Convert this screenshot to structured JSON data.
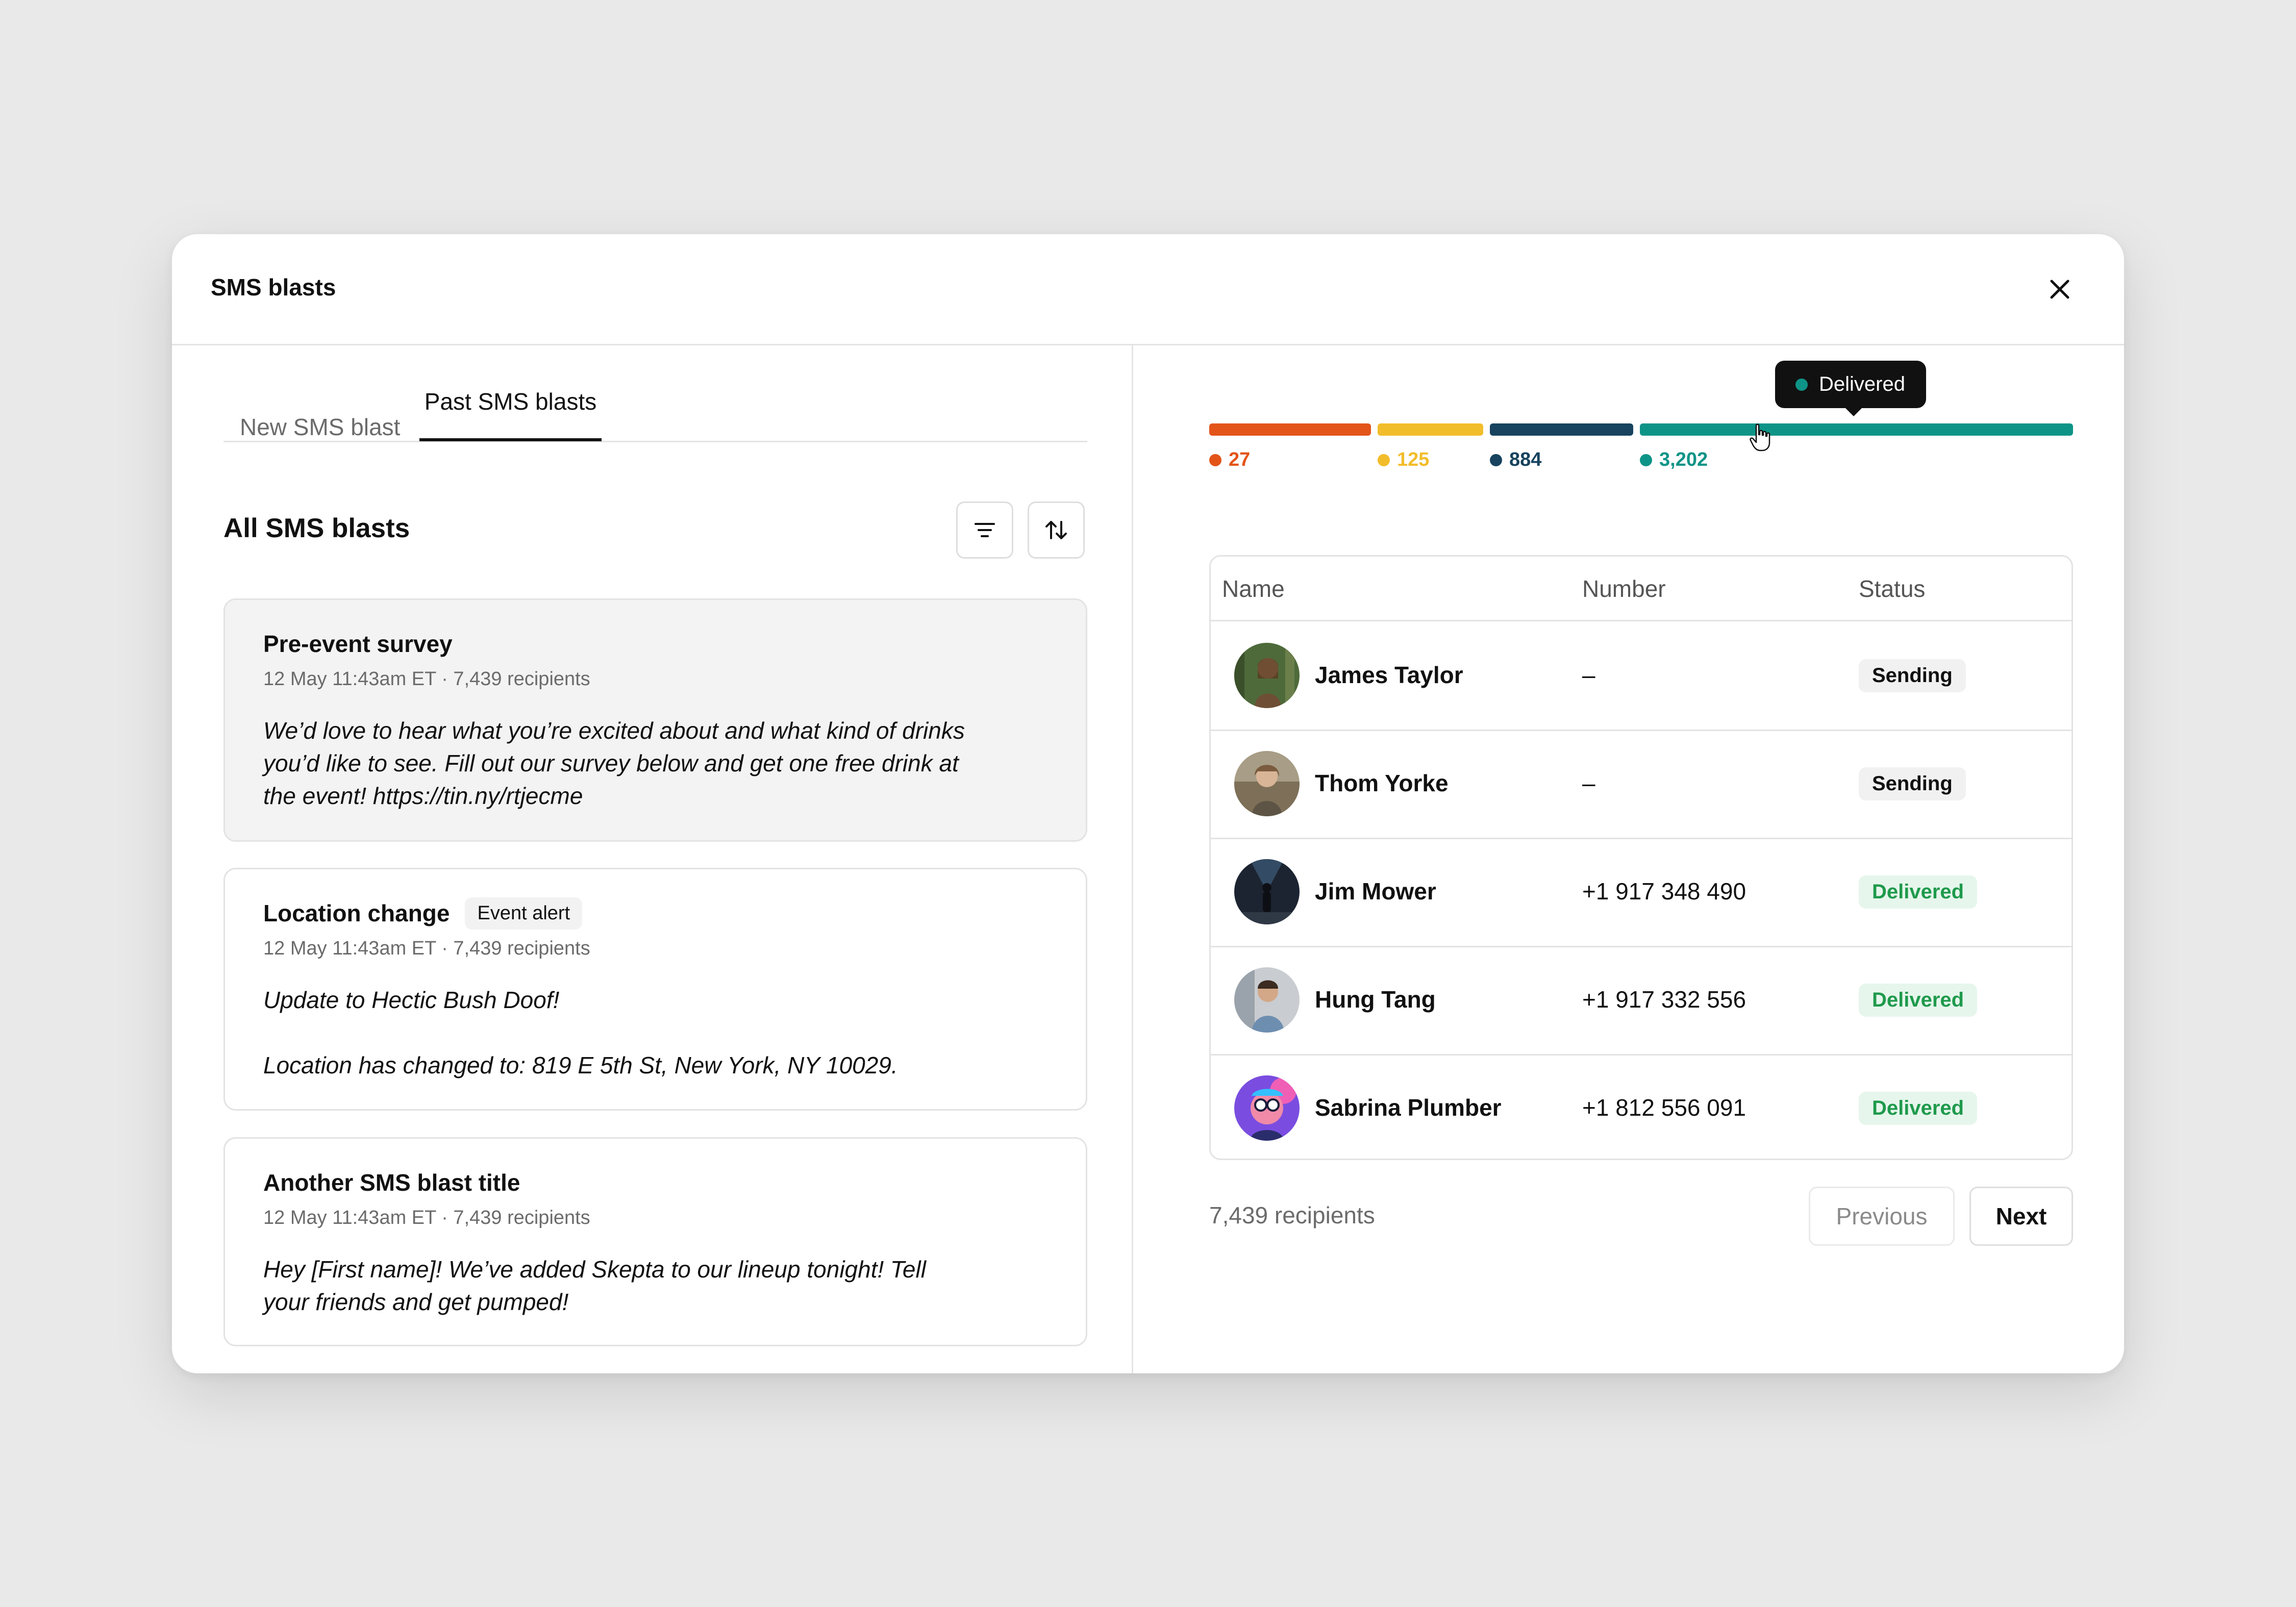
{
  "modal": {
    "title": "SMS blasts",
    "close_icon": "close-icon"
  },
  "tabs": [
    {
      "label": "New SMS blast",
      "active": false
    },
    {
      "label": "Past SMS blasts",
      "active": true
    }
  ],
  "list": {
    "title": "All SMS blasts",
    "filter_icon": "filter-icon",
    "sort_icon": "sort-arrows-icon",
    "cards": [
      {
        "title": "Pre-event survey",
        "badge": "",
        "meta": "12 May 11:43am ET · 7,439 recipients",
        "body": [
          "We’d love to hear what you’re excited about and what kind of drinks you’d like to see. Fill out our survey below and get one free drink at the event! https://tin.ny/rtjecme"
        ],
        "selected": true
      },
      {
        "title": "Location change",
        "badge": "Event alert",
        "meta": "12 May 11:43am ET · 7,439 recipients",
        "body": [
          "Update to Hectic Bush Doof!",
          "Location has changed to: 819 E 5th St, New York, NY 10029."
        ],
        "selected": false
      },
      {
        "title": "Another SMS blast title",
        "badge": "",
        "meta": "12 May 11:43am ET · 7,439 recipients",
        "body": [
          "Hey [First name]! We’ve added Skepta to our lineup tonight! Tell your friends and get pumped!"
        ],
        "selected": false
      }
    ]
  },
  "delivery_bar": {
    "segments": [
      {
        "value": "27",
        "color": "#e35419"
      },
      {
        "value": "125",
        "color": "#f2bd2b"
      },
      {
        "value": "884",
        "color": "#17435e"
      },
      {
        "value": "3,202",
        "color": "#0e9487"
      }
    ],
    "tooltip": "Delivered"
  },
  "table": {
    "headers": [
      "Name",
      "Number",
      "Status"
    ],
    "rows": [
      {
        "name": "James Taylor",
        "number": "–",
        "status": "Sending"
      },
      {
        "name": "Thom Yorke",
        "number": "–",
        "status": "Sending"
      },
      {
        "name": "Jim Mower",
        "number": "+1 917 348 490",
        "status": "Delivered"
      },
      {
        "name": "Hung Tang",
        "number": "+1 917 332 556",
        "status": "Delivered"
      },
      {
        "name": "Sabrina Plumber",
        "number": "+1 812 556 091",
        "status": "Delivered"
      }
    ]
  },
  "footer": {
    "count": "7,439 recipients",
    "previous": "Previous",
    "next": "Next"
  }
}
